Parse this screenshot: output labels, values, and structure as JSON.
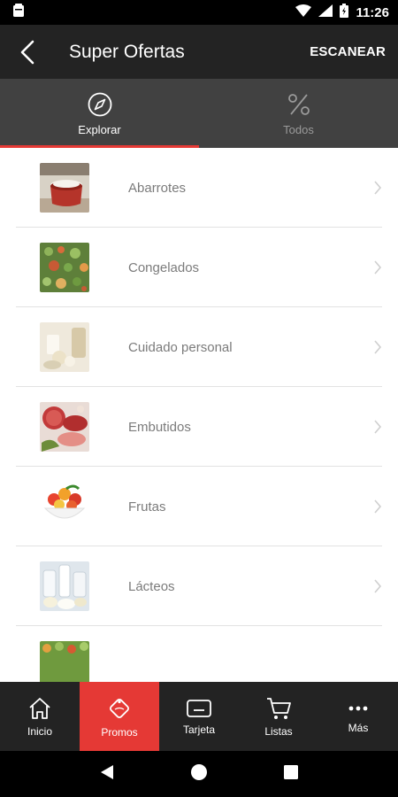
{
  "status_bar": {
    "time": "11:26"
  },
  "app_bar": {
    "title": "Super Ofertas",
    "action": "ESCANEAR"
  },
  "tabs": [
    {
      "label": "Explorar",
      "icon": "compass-icon",
      "active": true
    },
    {
      "label": "Todos",
      "icon": "percent-icon",
      "active": false
    }
  ],
  "categories": [
    {
      "label": "Abarrotes",
      "icon": "grocery-pot-thumbnail"
    },
    {
      "label": "Congelados",
      "icon": "frozen-vegetables-thumbnail"
    },
    {
      "label": "Cuidado personal",
      "icon": "personal-care-thumbnail"
    },
    {
      "label": "Embutidos",
      "icon": "cold-cuts-thumbnail"
    },
    {
      "label": "Frutas",
      "icon": "fruit-bowl-thumbnail"
    },
    {
      "label": "Lácteos",
      "icon": "dairy-thumbnail"
    }
  ],
  "bottom_nav": [
    {
      "label": "Inicio",
      "icon": "home-icon",
      "active": false
    },
    {
      "label": "Promos",
      "icon": "promo-tag-icon",
      "active": true
    },
    {
      "label": "Tarjeta",
      "icon": "card-icon",
      "active": false
    },
    {
      "label": "Listas",
      "icon": "cart-icon",
      "active": false
    },
    {
      "label": "Más",
      "icon": "more-icon",
      "active": false
    }
  ],
  "colors": {
    "accent": "#e53935",
    "app_bar": "#232323",
    "tab_bar": "#414141"
  }
}
